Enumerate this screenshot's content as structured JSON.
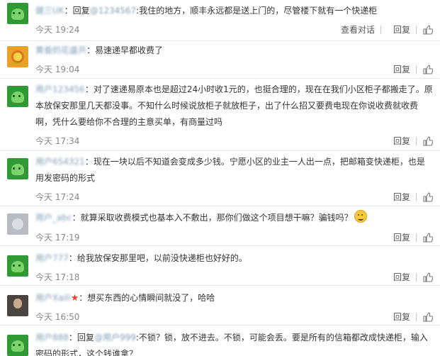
{
  "labels": {
    "reply": "回复",
    "view_conversation": "查看对话"
  },
  "comments": [
    {
      "avatar": "green-cartoon-avatar",
      "username": "健三UK",
      "colon": "：",
      "reply_prefix": "回复",
      "mention": "@1234567",
      "mention_colon": ":",
      "text": "我住的地方，顺丰永远都是送上门的，尽管楼下就有一个快递柜",
      "time": "今天 19:24",
      "has_view_conversation": true
    },
    {
      "avatar": "flower-avatar",
      "username": "黄昏的花盛开",
      "colon": "：",
      "text": "易速递早都收费了",
      "time": "今天 19:04"
    },
    {
      "avatar": "green-cartoon-avatar",
      "username": "用户123456",
      "colon": "：",
      "text": "对了速递易原本也是超过24小时收1元的，也挺合理的，现在在我们小区柜子都搬走了。原本放保安那里几天都没事。不知什么时候说放柜子就放柜子，出了什么招又要费电现在你说收费就收费啊，凭什么要给你不合理的主意买单，有商量过吗",
      "time": "今天 17:34"
    },
    {
      "avatar": "green-cartoon-avatar",
      "username": "用户654321",
      "colon": "：",
      "text": "现在一块以后不知道会变成多少钱。宁愿小区的业主一人出一点，把邮箱变快递柜，也是用发密码的形式",
      "time": "今天 17:24"
    },
    {
      "avatar": "gray-photo-avatar",
      "username": "用户_abc",
      "colon": "：",
      "text": "就算采取收费模式也基本入不敷出，那你们做这个项目想干嘛？骗钱吗？",
      "time": "今天 17:19",
      "emoji": "grin-emoji"
    },
    {
      "avatar": "green-cartoon-avatar",
      "username": "用户777",
      "colon": "：",
      "text": "给我放保安那里吧，以前没快递柜也好好的。",
      "time": "今天 17:18"
    },
    {
      "avatar": "dark-photo-avatar",
      "username": "用户Xaili",
      "badge": "★",
      "colon": "：",
      "text": "想买东西的心情瞬间就没了，哈哈",
      "time": "今天 16:50"
    },
    {
      "avatar": "green-cartoon-avatar",
      "username": "用户888",
      "colon": "：",
      "reply_prefix": "回复",
      "mention": "@用户999",
      "mention_colon": ":",
      "text": "不锁？锁，放不进去。不锁，可能会丢。要是所有的信箱都改成快递柜，输入密码的形式，这个钱谁拿？"
    }
  ]
}
